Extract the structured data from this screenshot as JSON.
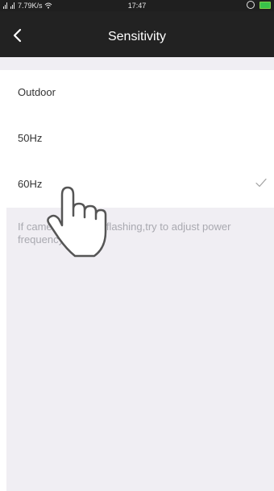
{
  "statusbar": {
    "network_speed": "7.79K/s",
    "time": "17:47",
    "icons": [
      "signal-icon",
      "signal-icon",
      "wifi-icon",
      "alarm-icon",
      "battery-icon"
    ]
  },
  "header": {
    "title": "Sensitivity",
    "back_icon": "chevron-left-icon"
  },
  "options": [
    {
      "label": "Outdoor",
      "selected": false
    },
    {
      "label": "50Hz",
      "selected": false
    },
    {
      "label": "60Hz",
      "selected": true
    }
  ],
  "hint": "If camera image is flashing,try to adjust power frequency",
  "colors": {
    "header_bg": "#222222",
    "page_bg": "#f0eef3",
    "check": "#a0a0a0",
    "hint_text": "#a9a9b0"
  }
}
